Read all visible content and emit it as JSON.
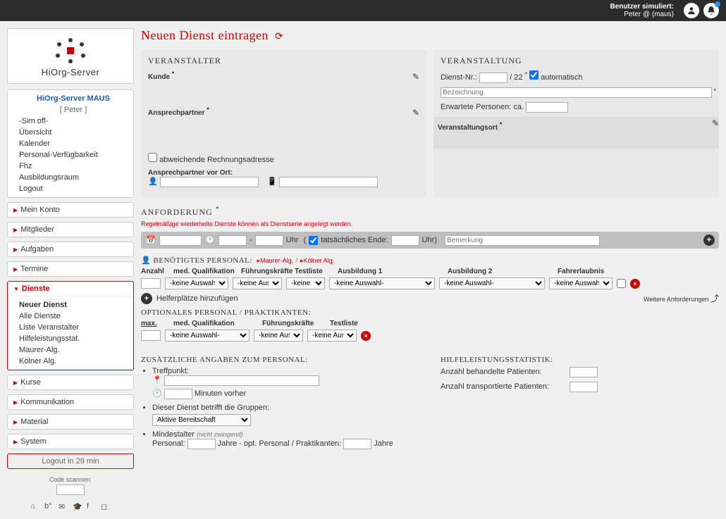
{
  "topbar": {
    "simulated_label": "Benutzer simuliert:",
    "user_name": "Peter @ (maus)"
  },
  "logo": {
    "brand": "HiOrg-Server"
  },
  "sidebar": {
    "org_panel": {
      "title": "HiOrg-Server MAUS",
      "user": "[ Peter ]",
      "items": [
        "-Sim off-",
        "Übersicht",
        "Kalender",
        "Personal-Verfügbarkeit",
        "Fhz",
        "Ausbildungsraum",
        "Logout"
      ]
    },
    "panels": [
      {
        "label": "Mein Konto"
      },
      {
        "label": "Mitglieder"
      },
      {
        "label": "Aufgaben"
      },
      {
        "label": "Termine"
      }
    ],
    "active_panel": {
      "label": "Dienste",
      "items": [
        "Neuer Dienst",
        "Alle Dienste",
        "Liste Veranstalter",
        "Hilfeleistungsstat.",
        "Maurer-Alg.",
        "Kölner Alg."
      ],
      "bold_index": 0
    },
    "after_panels": [
      {
        "label": "Kurse"
      },
      {
        "label": "Kommunikation"
      },
      {
        "label": "Material"
      },
      {
        "label": "System"
      }
    ],
    "logout_timer": "Logout in 29 min",
    "qr_label": "Code scannen:"
  },
  "page_title": "Neuen Dienst eintragen",
  "veranstalter": {
    "heading": "VERANSTALTER",
    "kunde_label": "Kunde",
    "ansprechpartner_label": "Ansprechpartner",
    "abweichende_label": "abweichende Rechnungsadresse",
    "vorort_label": "Ansprechpartner vor Ort:"
  },
  "veranstaltung": {
    "heading": "VERANSTALTUNG",
    "dienstnr_label": "Dienst-Nr.:",
    "dienstnr_suffix": "/ 22",
    "auto_label": "automatisch",
    "bezeichnung_placeholder": "Bezeichnung",
    "erwartete_label": "Erwartete Personen: ca.",
    "ort_label": "Veranstaltungsort"
  },
  "anforderung": {
    "heading": "ANFORDERUNG",
    "hint": "Regelmäßige wiederholte Dienste können als Dienstserie angelegt werden.",
    "uhr": "Uhr",
    "dash": "-",
    "tats_label": "tatsächliches Ende:",
    "uhr_paren": "Uhr)",
    "bemerkung_placeholder": "Bemerkung"
  },
  "personal": {
    "heading": "BENÖTIGTES PERSONAL:",
    "link1": "Maurer-Alg.",
    "link_sep": "/",
    "link2": "Kölner Alg.",
    "headers": [
      "Anzahl",
      "med. Qualifikation",
      "Führungskräfte",
      "Testliste",
      "Ausbildung 1",
      "Ausbildung 2",
      "Fahrerlaubnis"
    ],
    "keine_auswahl": "-keine Auswahl-",
    "add_label": "Helferplätze hinzufügen",
    "weitere": "Weitere Anforderungen"
  },
  "optional": {
    "heading": "OPTIONALES PERSONAL / PRAKTIKANTEN:",
    "headers": [
      "max.",
      "med. Qualifikation",
      "Führungskräfte",
      "Testliste"
    ]
  },
  "zusatz": {
    "heading": "ZUSÄTZLICHE ANGABEN ZUM PERSONAL:",
    "treffpunkt": "Treffpunkt:",
    "min_vorher": "Minuten vorher",
    "gruppen": "Dieser Dienst betrifft die Gruppen:",
    "gruppen_sel": "Aktive Bereitschaft",
    "mindestalter": "Mindestalter",
    "mindestalter_hint": "(nicht zwingend)",
    "pers_label": "Personal:",
    "jahre": "Jahre",
    "opt_label": "- opt. Personal / Praktikanten:"
  },
  "stats": {
    "heading": "HILFELEISTUNGSSTATISTIK:",
    "behandelte": "Anzahl behandelte Patienten:",
    "transportierte": "Anzahl transportierte Patienten:"
  }
}
